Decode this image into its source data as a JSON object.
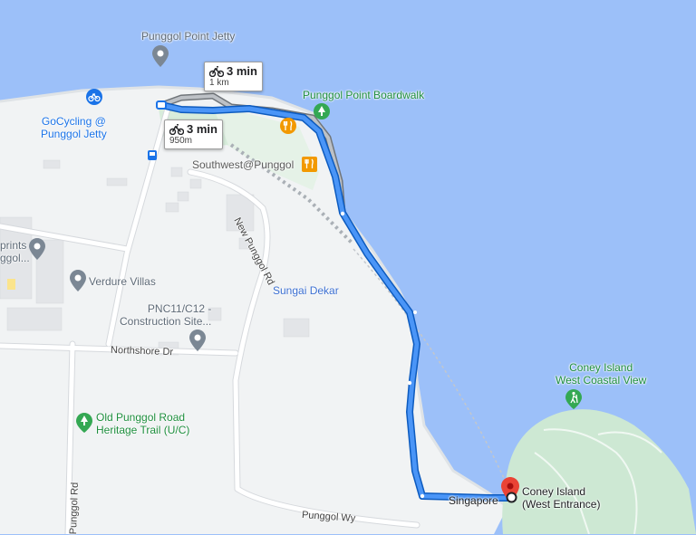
{
  "map": {
    "colors": {
      "water": "#9cc0f9",
      "land": "#f1f3f4",
      "park": "#cde8d3",
      "route_active": "#1a73e8",
      "route_alt": "#9aa0a6",
      "destination_pin": "#ea4335"
    },
    "pois": [
      {
        "id": "punggol-point-jetty",
        "label": "Punggol Point Jetty",
        "icon": "location-pin-icon"
      },
      {
        "id": "punggol-point-boardwalk",
        "label": "Punggol Point Boardwalk",
        "icon": "tree-icon"
      },
      {
        "id": "gocycling",
        "label": "GoCycling @\nPunggol Jetty",
        "icon": "bicycle-icon"
      },
      {
        "id": "southwest-punggol",
        "label": "Southwest@Punggol",
        "icon": "restaurant-icon"
      },
      {
        "id": "sprints",
        "label": "prints\nggol...",
        "icon": "location-pin-icon"
      },
      {
        "id": "verdure-villas",
        "label": "Verdure Villas",
        "icon": "location-pin-icon"
      },
      {
        "id": "pnc11",
        "label": "PNC11/C12 -\nConstruction Site...",
        "icon": "location-pin-icon"
      },
      {
        "id": "old-punggol",
        "label": "Old Punggol Road\nHeritage Trail (U/C)",
        "icon": "tree-icon"
      },
      {
        "id": "coney-west-view",
        "label": "Coney Island\nWest Coastal View",
        "icon": "hiking-icon"
      },
      {
        "id": "coney-west-entrance",
        "label": "Coney Island\n(West Entrance)",
        "icon": "destination-pin-icon"
      }
    ],
    "roads": {
      "new_punggol_rd": "New Punggol Rd",
      "northshore_dr": "Northshore Dr",
      "punggol_wy": "Punggol Wy",
      "punggol_rd": "Punggol Rd"
    },
    "water_labels": {
      "sungai_dekar": "Sungai Dekar"
    },
    "place_labels": {
      "singapore": "Singapore"
    },
    "routes": [
      {
        "id": "alt",
        "mode": "bicycle",
        "time": "3 min",
        "distance": "1 km"
      },
      {
        "id": "main",
        "mode": "bicycle",
        "time": "3 min",
        "distance": "950m"
      }
    ]
  }
}
